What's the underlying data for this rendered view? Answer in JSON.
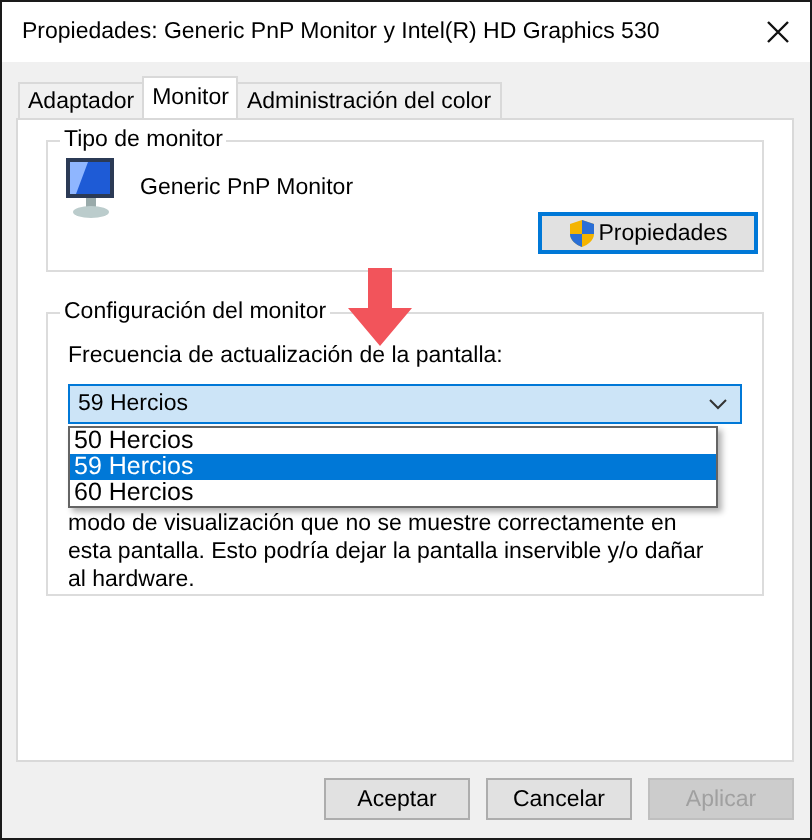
{
  "window": {
    "title": "Propiedades: Generic PnP Monitor y Intel(R) HD Graphics 530"
  },
  "tabs": [
    {
      "label": "Adaptador",
      "selected": false
    },
    {
      "label": "Monitor",
      "selected": true
    },
    {
      "label": "Administración del color",
      "selected": false
    }
  ],
  "monitor_type": {
    "title": "Tipo de monitor",
    "monitor_name": "Generic PnP Monitor",
    "button": "Propiedades"
  },
  "monitor_settings": {
    "title": "Configuración del monitor",
    "refresh_label": "Frecuencia de actualización de la pantalla:",
    "refresh_select": {
      "value": "59 Hercios",
      "expanded": true,
      "options": [
        {
          "label": "50 Hercios",
          "selected": false
        },
        {
          "label": "59 Hercios",
          "selected": true
        },
        {
          "label": "60 Hercios",
          "selected": false
        }
      ]
    },
    "warning": "modo de visualización que no se muestre correctamente en esta pantalla. Esto podría dejar la pantalla inservible y/o dañar al hardware."
  },
  "buttons": [
    {
      "label": "Aceptar",
      "disabled": false
    },
    {
      "label": "Cancelar",
      "disabled": false
    },
    {
      "label": "Aplicar",
      "disabled": true
    }
  ]
}
